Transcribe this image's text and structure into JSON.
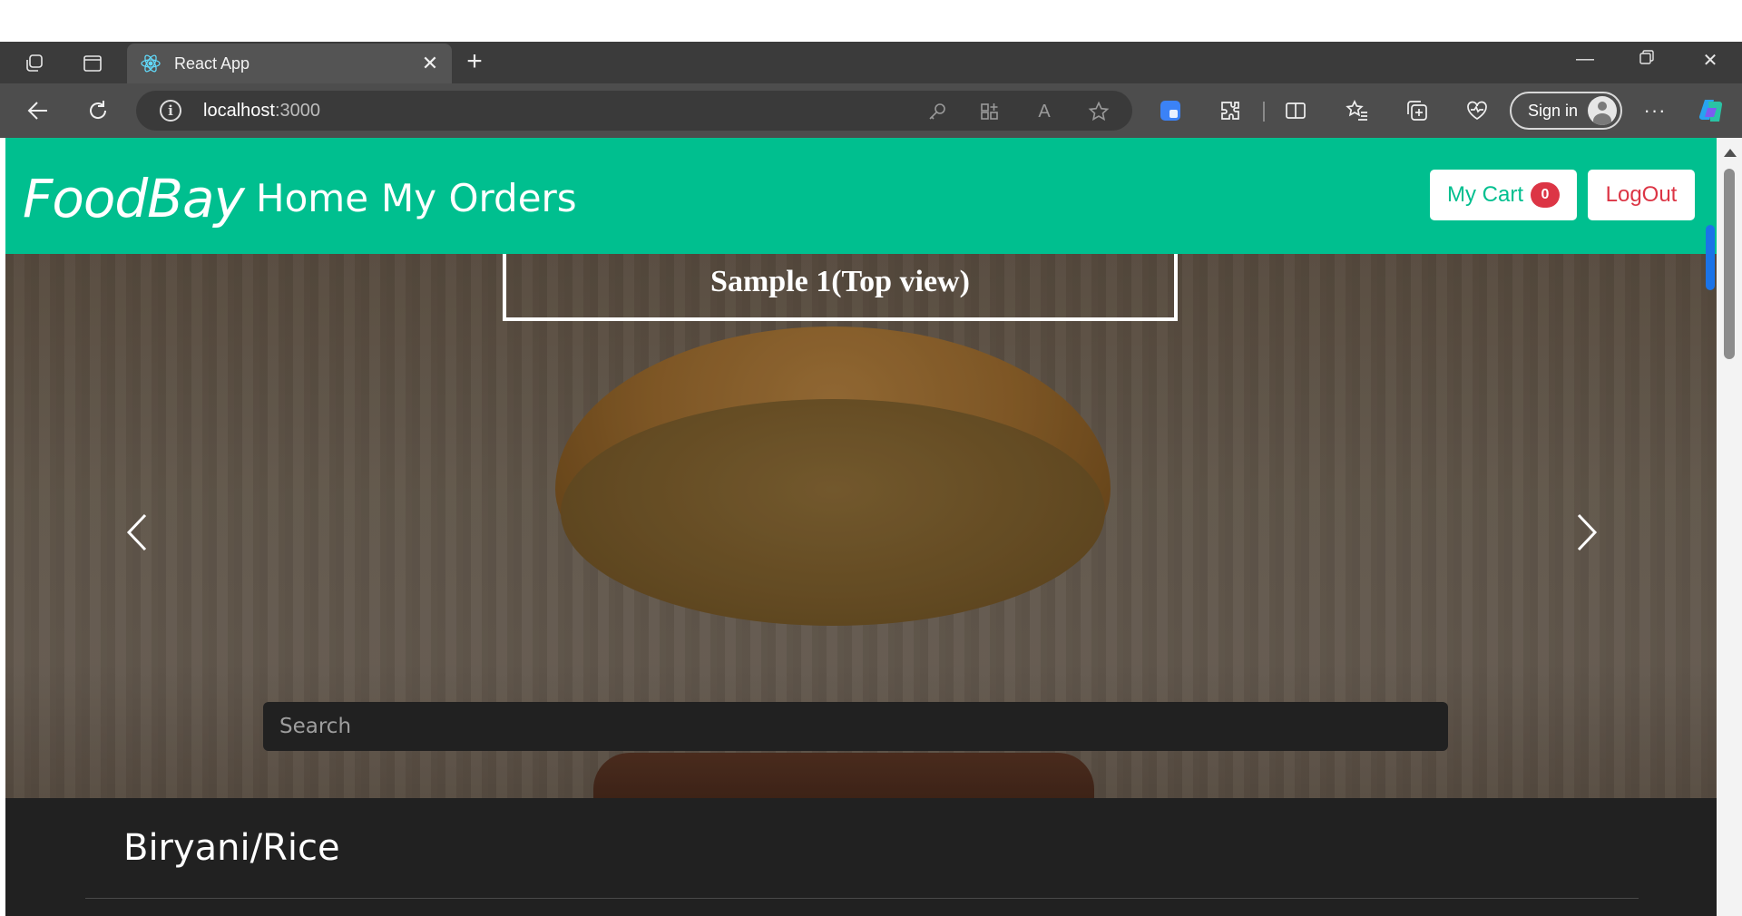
{
  "browser": {
    "tab_title": "React App",
    "url_host": "localhost",
    "url_port": ":3000",
    "sign_in_label": "Sign in"
  },
  "app": {
    "brand": "FoodBay",
    "nav": {
      "home": "Home",
      "orders": "My Orders"
    },
    "cart_label": "My Cart",
    "cart_count": "0",
    "logout_label": "LogOut",
    "accent_color": "#00bf8f",
    "danger_color": "#dc3545"
  },
  "carousel": {
    "caption": "Sample 1(Top view)",
    "search_placeholder": "Search"
  },
  "category": {
    "title": "Biryani/Rice"
  }
}
